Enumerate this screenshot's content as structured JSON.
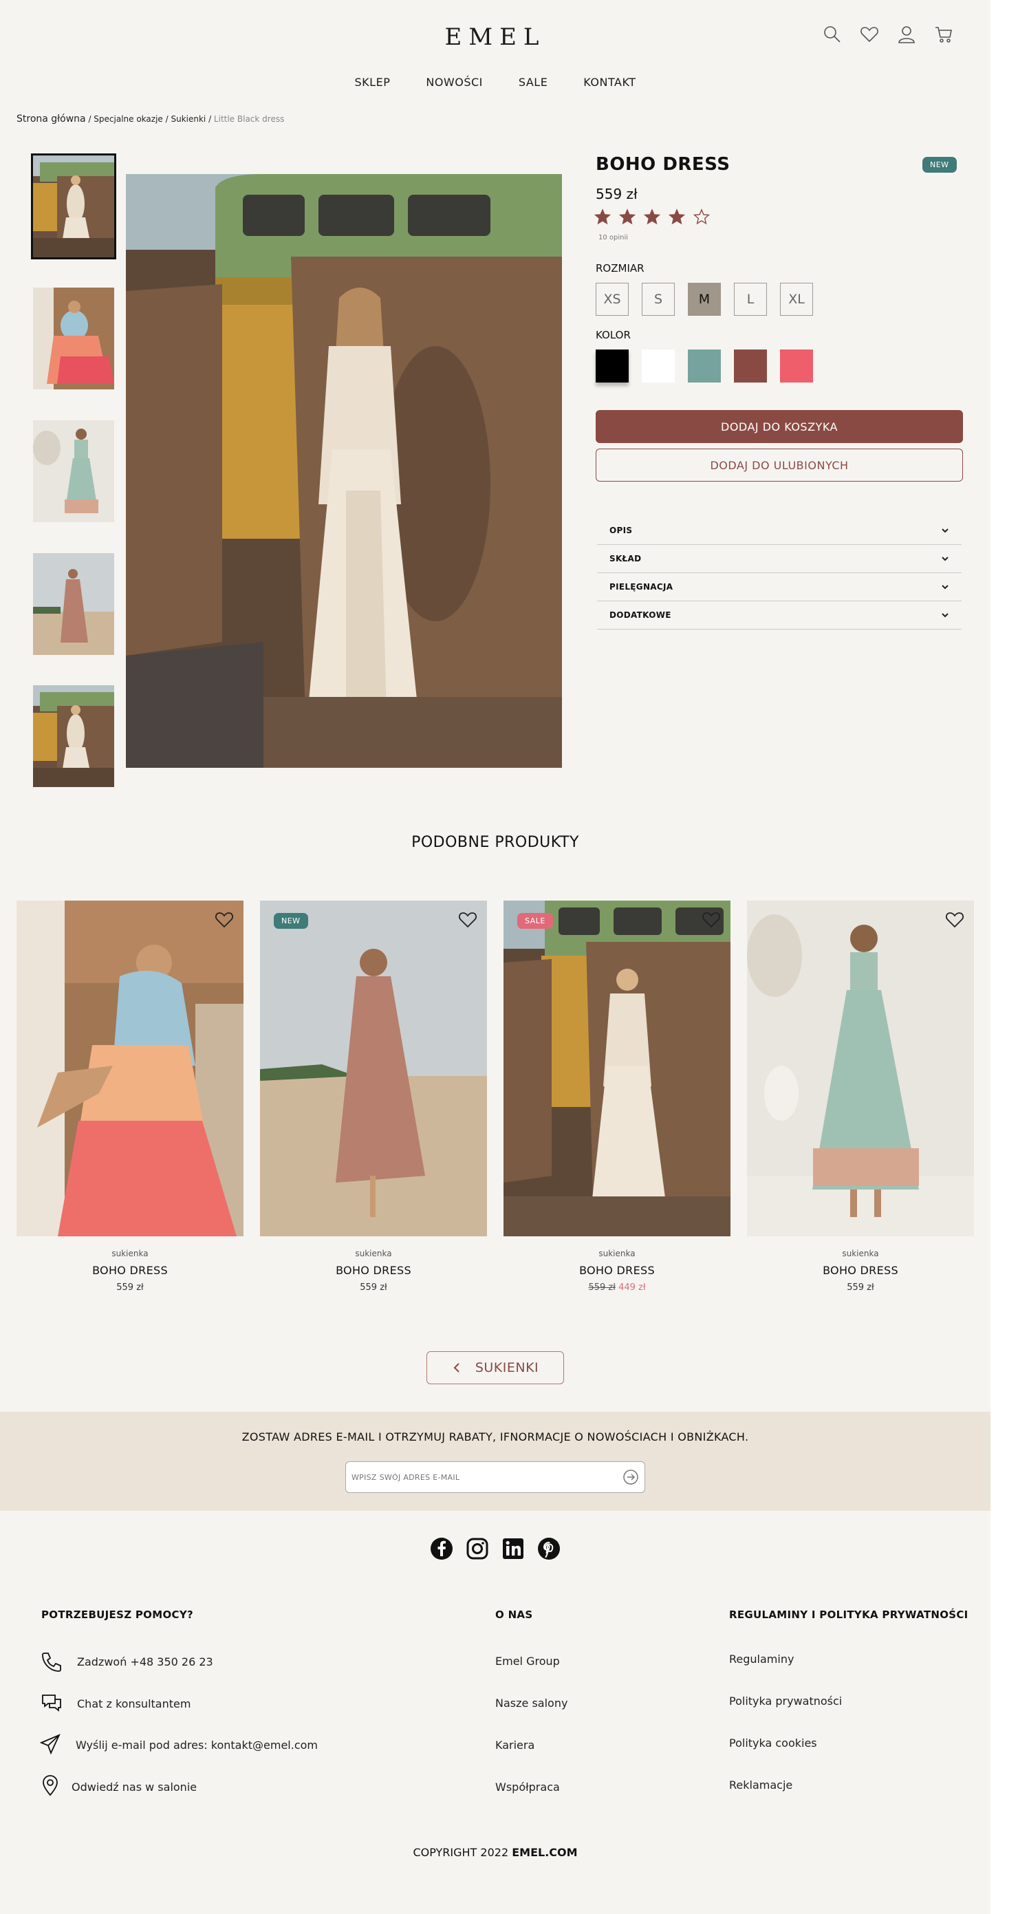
{
  "header": {
    "logo": "EMEL",
    "icons": [
      "search-icon",
      "heart-icon",
      "user-icon",
      "cart-icon"
    ]
  },
  "nav": [
    "SKLEP",
    "NOWOŚCI",
    "SALE",
    "KONTAKT"
  ],
  "breadcrumb": {
    "home": "Strona główna",
    "sep": " / ",
    "c1": "Specjalne okazje",
    "c2": "Sukienki",
    "current": "Little Black dress"
  },
  "product": {
    "title": "BOHO DRESS",
    "badge": "NEW",
    "price": "559 zł",
    "rating": 4,
    "rating_max": 5,
    "reviews": "10 opinii",
    "size_label": "ROZMIAR",
    "sizes": [
      "XS",
      "S",
      "M",
      "L",
      "XL"
    ],
    "selected_size": "M",
    "color_label": "KOLOR",
    "colors": [
      "#000000",
      "#ffffff",
      "#76a39e",
      "#8a4a44",
      "#ee5e6b"
    ],
    "add_to_cart": "DODAJ DO KOSZYKA",
    "add_to_fav": "DODAJ DO ULUBIONYCH",
    "accordion": [
      "OPIS",
      "SKŁAD",
      "PIELĘGNACJA",
      "DODATKOWE"
    ]
  },
  "similar": {
    "title": "PODOBNE PRODUKTY",
    "items": [
      {
        "category": "sukienka",
        "name": "BOHO DRESS",
        "price": "559 zł",
        "badge": ""
      },
      {
        "category": "sukienka",
        "name": "BOHO DRESS",
        "price": "559 zł",
        "badge": "NEW"
      },
      {
        "category": "sukienka",
        "name": "BOHO DRESS",
        "old_price": "559 zł",
        "price": "449 zł",
        "badge": "SALE"
      },
      {
        "category": "sukienka",
        "name": "BOHO DRESS",
        "price": "559 zł",
        "badge": ""
      }
    ],
    "back_button": "SUKIENKI"
  },
  "newsletter": {
    "text": "ZOSTAW ADRES E-MAIL I OTRZYMUJ RABATY, IFNORMACJE O NOWOŚCIACH I OBNIŻKACH.",
    "placeholder": "WPISZ SWÓJ ADRES E-MAIL"
  },
  "social": [
    "facebook-icon",
    "instagram-icon",
    "linkedin-icon",
    "pinterest-icon"
  ],
  "footer": {
    "help": {
      "title": "POTRZEBUJESZ POMOCY?",
      "items": [
        "Zadzwoń +48 350 26 23",
        "Chat z konsultantem",
        "Wyślij e-mail pod adres: kontakt@emel.com",
        "Odwiedź nas w salonie"
      ]
    },
    "about": {
      "title": "O NAS",
      "items": [
        "Emel Group",
        "Nasze salony",
        "Kariera",
        "Współpraca"
      ]
    },
    "legal": {
      "title": "REGULAMINY I POLITYKA PRYWATNOŚCI",
      "items": [
        "Regulaminy",
        "Polityka prywatności",
        "Polityka cookies",
        "Reklamacje"
      ]
    },
    "copyright_prefix": "COPYRIGHT 2022 ",
    "copyright_brand": "EMEL.COM"
  },
  "colors": {
    "accent": "#8a4a44",
    "new_badge": "#3f7b78",
    "sale_badge": "#e06a78",
    "background": "#f6f4f1",
    "newsletter_bg": "#ebe3d7"
  }
}
